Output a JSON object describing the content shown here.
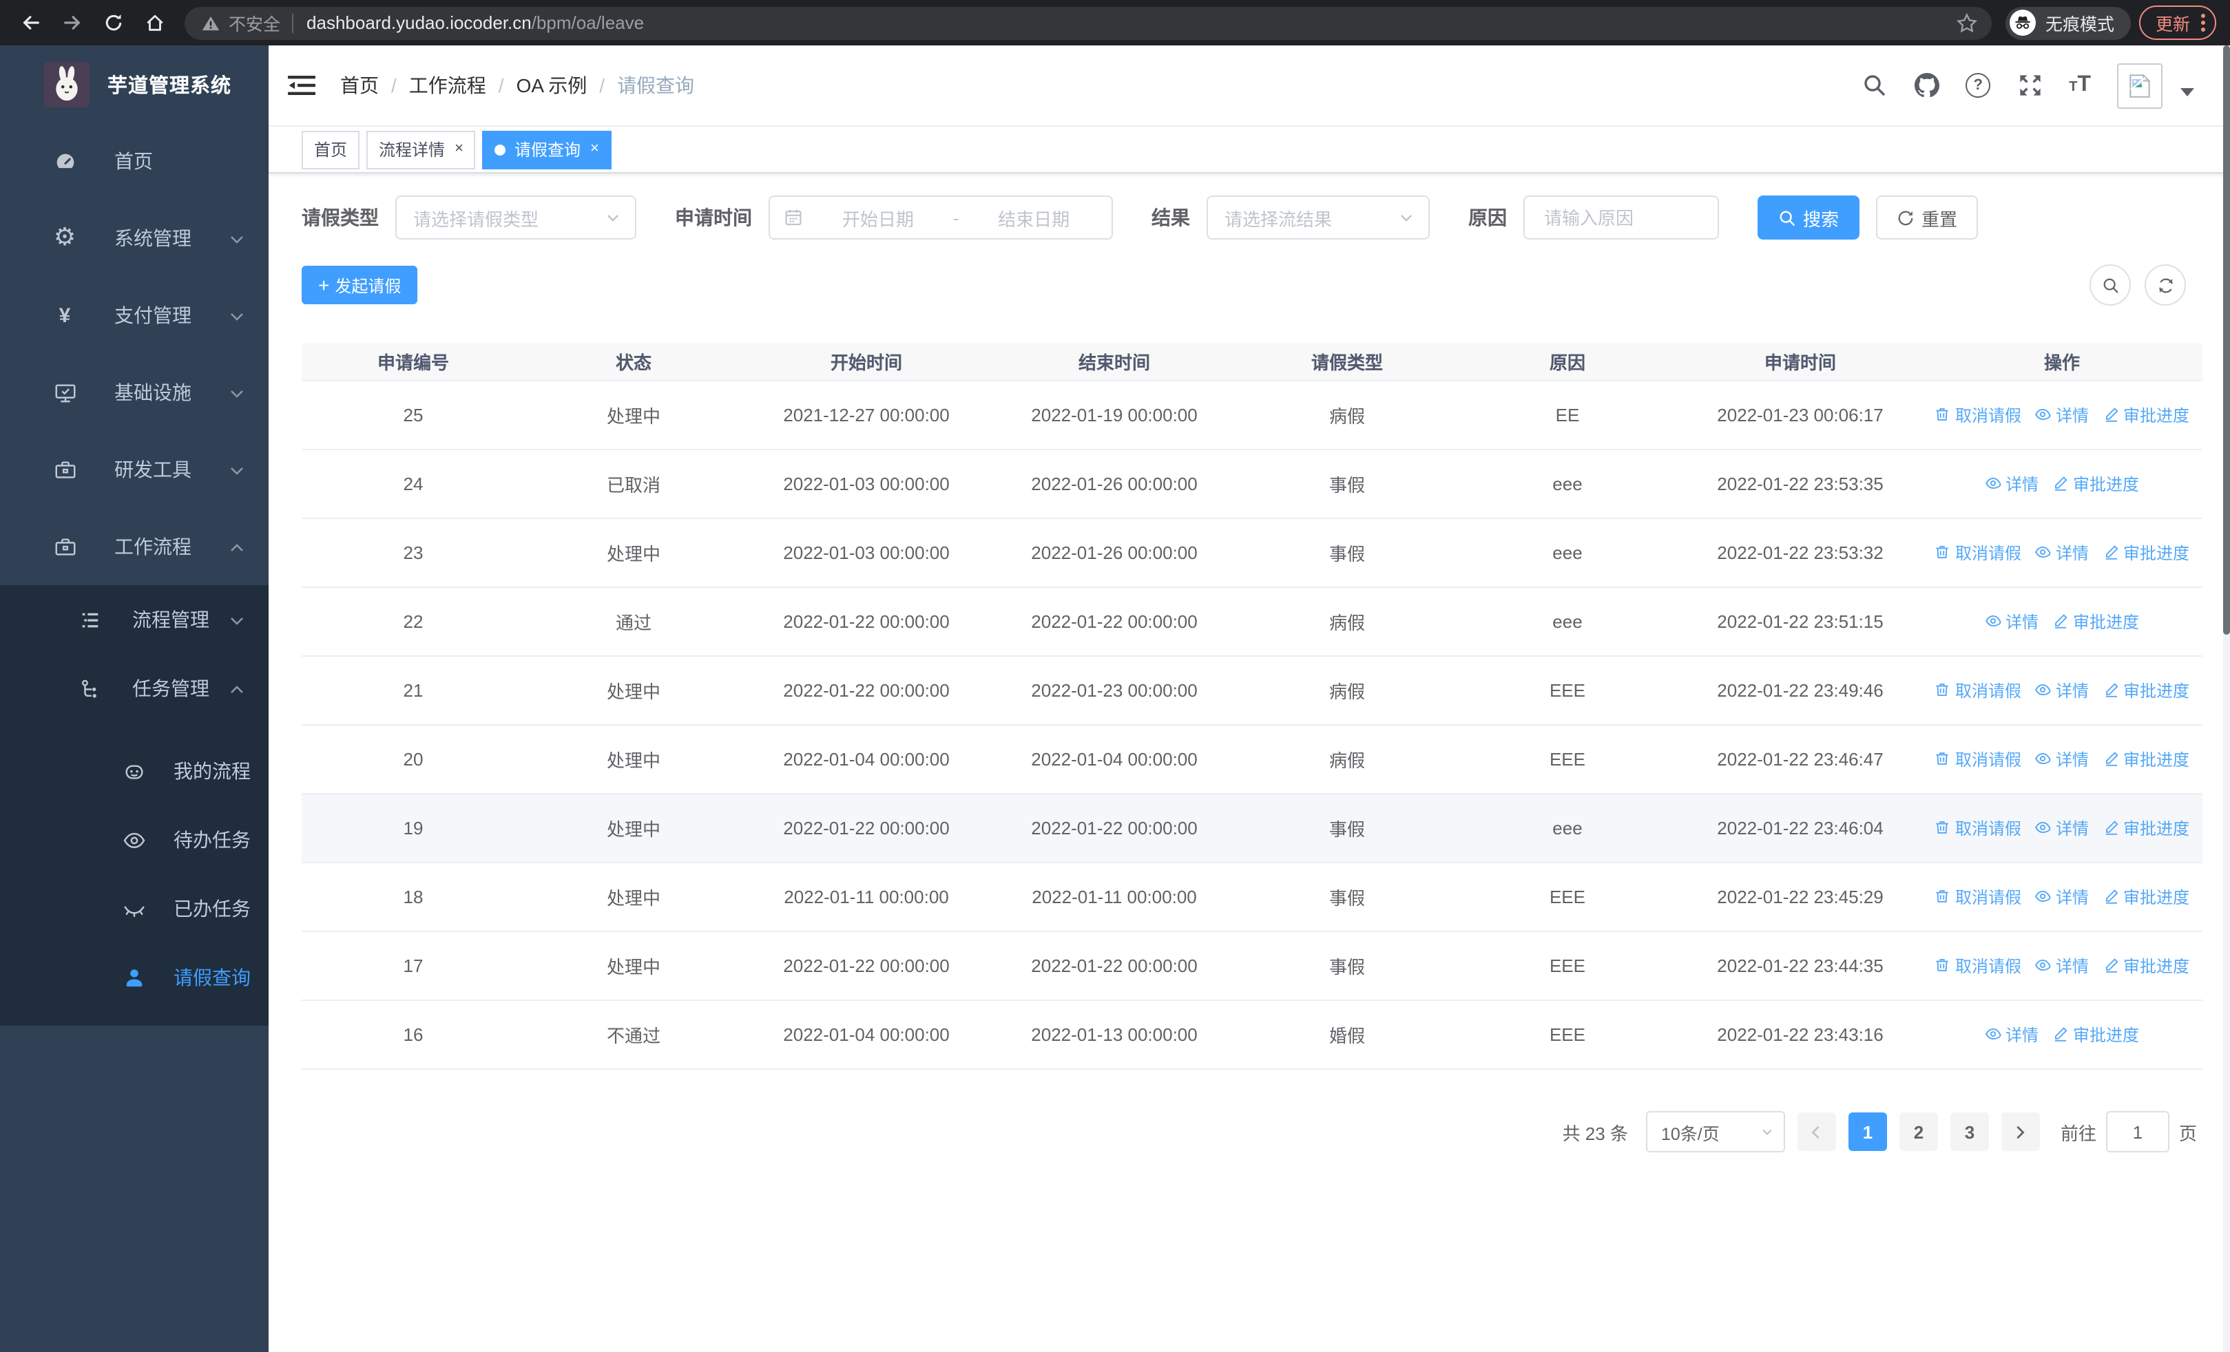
{
  "browser": {
    "security_label": "不安全",
    "url_host": "dashboard.yudao.iocoder.cn",
    "url_path": "/bpm/oa/leave",
    "incognito_label": "无痕模式",
    "update_label": "更新"
  },
  "sidebar": {
    "title": "芋道管理系统",
    "menu": [
      {
        "key": "home",
        "label": "首页",
        "icon": "dashboard-icon"
      },
      {
        "key": "system",
        "label": "系统管理",
        "icon": "gear-icon",
        "arrow": "down"
      },
      {
        "key": "payment",
        "label": "支付管理",
        "icon": "yen-icon",
        "arrow": "down"
      },
      {
        "key": "infrastructure",
        "label": "基础设施",
        "icon": "monitor-icon",
        "arrow": "down"
      },
      {
        "key": "dev-tools",
        "label": "研发工具",
        "icon": "toolbox-icon",
        "arrow": "down"
      },
      {
        "key": "workflow",
        "label": "工作流程",
        "icon": "briefcase-icon",
        "arrow": "up",
        "expanded": true,
        "children": [
          {
            "key": "process-management",
            "label": "流程管理",
            "icon": "list-tree-icon",
            "arrow": "down"
          },
          {
            "key": "task-management",
            "label": "任务管理",
            "icon": "flow-icon",
            "arrow": "up",
            "expanded": true,
            "children": [
              {
                "key": "my-process",
                "label": "我的流程",
                "icon": "robot-icon"
              },
              {
                "key": "todo-tasks",
                "label": "待办任务",
                "icon": "eye-icon"
              },
              {
                "key": "done-tasks",
                "label": "已办任务",
                "icon": "eye-closed-icon"
              },
              {
                "key": "leave-query",
                "label": "请假查询",
                "icon": "user-icon",
                "active": true
              }
            ]
          }
        ]
      }
    ]
  },
  "header": {
    "breadcrumb": [
      "首页",
      "工作流程",
      "OA 示例",
      "请假查询"
    ]
  },
  "tabs": [
    {
      "key": "home",
      "label": "首页"
    },
    {
      "key": "process-detail",
      "label": "流程详情",
      "closable": true
    },
    {
      "key": "leave-query",
      "label": "请假查询",
      "closable": true,
      "active": true
    }
  ],
  "filters": {
    "leave_type_label": "请假类型",
    "leave_type_placeholder": "请选择请假类型",
    "apply_time_label": "申请时间",
    "start_date_placeholder": "开始日期",
    "range_separator": "-",
    "end_date_placeholder": "结束日期",
    "result_label": "结果",
    "result_placeholder": "请选择流结果",
    "reason_label": "原因",
    "reason_placeholder": "请输入原因",
    "search_label": "搜索",
    "reset_label": "重置"
  },
  "toolbar": {
    "create_label": "发起请假"
  },
  "table": {
    "columns": [
      "申请编号",
      "状态",
      "开始时间",
      "结束时间",
      "请假类型",
      "原因",
      "申请时间",
      "操作"
    ],
    "action_labels": {
      "cancel": "取消请假",
      "detail": "详情",
      "progress": "审批进度"
    },
    "rows": [
      {
        "id": "25",
        "status": "处理中",
        "start": "2021-12-27 00:00:00",
        "end": "2022-01-19 00:00:00",
        "type": "病假",
        "reason": "EE",
        "applied": "2022-01-23 00:06:17",
        "actions": [
          "cancel",
          "detail",
          "progress"
        ]
      },
      {
        "id": "24",
        "status": "已取消",
        "start": "2022-01-03 00:00:00",
        "end": "2022-01-26 00:00:00",
        "type": "事假",
        "reason": "eee",
        "applied": "2022-01-22 23:53:35",
        "actions": [
          "detail",
          "progress"
        ]
      },
      {
        "id": "23",
        "status": "处理中",
        "start": "2022-01-03 00:00:00",
        "end": "2022-01-26 00:00:00",
        "type": "事假",
        "reason": "eee",
        "applied": "2022-01-22 23:53:32",
        "actions": [
          "cancel",
          "detail",
          "progress"
        ]
      },
      {
        "id": "22",
        "status": "通过",
        "start": "2022-01-22 00:00:00",
        "end": "2022-01-22 00:00:00",
        "type": "病假",
        "reason": "eee",
        "applied": "2022-01-22 23:51:15",
        "actions": [
          "detail",
          "progress"
        ]
      },
      {
        "id": "21",
        "status": "处理中",
        "start": "2022-01-22 00:00:00",
        "end": "2022-01-23 00:00:00",
        "type": "病假",
        "reason": "EEE",
        "applied": "2022-01-22 23:49:46",
        "actions": [
          "cancel",
          "detail",
          "progress"
        ]
      },
      {
        "id": "20",
        "status": "处理中",
        "start": "2022-01-04 00:00:00",
        "end": "2022-01-04 00:00:00",
        "type": "病假",
        "reason": "EEE",
        "applied": "2022-01-22 23:46:47",
        "actions": [
          "cancel",
          "detail",
          "progress"
        ]
      },
      {
        "id": "19",
        "status": "处理中",
        "start": "2022-01-22 00:00:00",
        "end": "2022-01-22 00:00:00",
        "type": "事假",
        "reason": "eee",
        "applied": "2022-01-22 23:46:04",
        "actions": [
          "cancel",
          "detail",
          "progress"
        ],
        "highlighted": true
      },
      {
        "id": "18",
        "status": "处理中",
        "start": "2022-01-11 00:00:00",
        "end": "2022-01-11 00:00:00",
        "type": "事假",
        "reason": "EEE",
        "applied": "2022-01-22 23:45:29",
        "actions": [
          "cancel",
          "detail",
          "progress"
        ]
      },
      {
        "id": "17",
        "status": "处理中",
        "start": "2022-01-22 00:00:00",
        "end": "2022-01-22 00:00:00",
        "type": "事假",
        "reason": "EEE",
        "applied": "2022-01-22 23:44:35",
        "actions": [
          "cancel",
          "detail",
          "progress"
        ]
      },
      {
        "id": "16",
        "status": "不通过",
        "start": "2022-01-04 00:00:00",
        "end": "2022-01-13 00:00:00",
        "type": "婚假",
        "reason": "EEE",
        "applied": "2022-01-22 23:43:16",
        "actions": [
          "detail",
          "progress"
        ]
      }
    ]
  },
  "pagination": {
    "total_label": "共 23 条",
    "page_size": "10条/页",
    "pages": [
      "1",
      "2",
      "3"
    ],
    "active_page": "1",
    "goto_label": "前往",
    "goto_value": "1",
    "page_unit": "页"
  },
  "colors": {
    "primary": "#409EFF",
    "sidebar_bg": "#304156",
    "submenu_bg": "#1f2d3d",
    "update_accent": "#f28b82"
  }
}
